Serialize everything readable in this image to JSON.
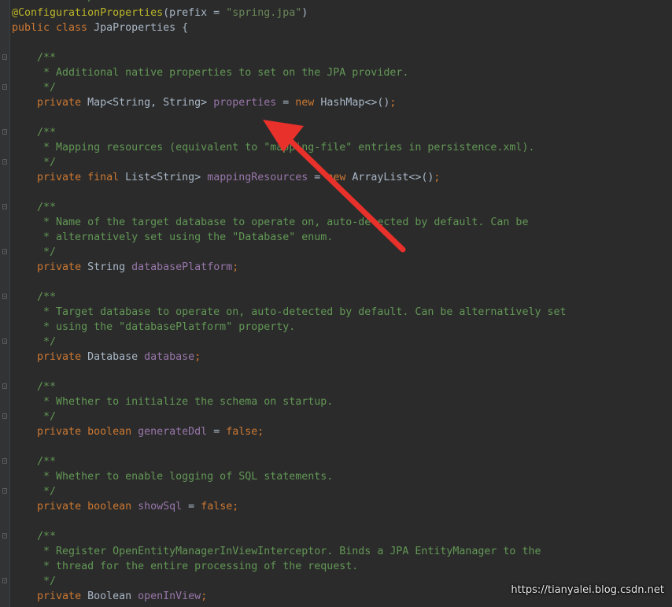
{
  "code_lines": [
    [
      {
        "c": "txt",
        "t": "           "
      },
      {
        "c": "doc",
        "t": "*/"
      }
    ],
    [
      {
        "c": "ann",
        "t": "@ConfigurationProperties"
      },
      {
        "c": "txt",
        "t": "(prefix = "
      },
      {
        "c": "str",
        "t": "\"spring.jpa\""
      },
      {
        "c": "txt",
        "t": ")"
      }
    ],
    [
      {
        "c": "kw",
        "t": "public class "
      },
      {
        "c": "txt",
        "t": "JpaProperties {"
      }
    ],
    [],
    [
      {
        "c": "txt",
        "t": "    "
      },
      {
        "c": "doc",
        "t": "/**"
      }
    ],
    [
      {
        "c": "txt",
        "t": "     "
      },
      {
        "c": "doc",
        "t": "* Additional native properties to set on the JPA provider."
      }
    ],
    [
      {
        "c": "txt",
        "t": "     "
      },
      {
        "c": "doc",
        "t": "*/"
      }
    ],
    [
      {
        "c": "txt",
        "t": "    "
      },
      {
        "c": "kw",
        "t": "private "
      },
      {
        "c": "txt",
        "t": "Map<String, String> "
      },
      {
        "c": "fld",
        "t": "properties"
      },
      {
        "c": "txt",
        "t": " = "
      },
      {
        "c": "kw",
        "t": "new "
      },
      {
        "c": "txt",
        "t": "HashMap<>()"
      },
      {
        "c": "kw",
        "t": ";"
      }
    ],
    [],
    [
      {
        "c": "txt",
        "t": "    "
      },
      {
        "c": "doc",
        "t": "/**"
      }
    ],
    [
      {
        "c": "txt",
        "t": "     "
      },
      {
        "c": "doc",
        "t": "* Mapping resources (equivalent to \"mapping-file\" entries in persistence.xml)."
      }
    ],
    [
      {
        "c": "txt",
        "t": "     "
      },
      {
        "c": "doc",
        "t": "*/"
      }
    ],
    [
      {
        "c": "txt",
        "t": "    "
      },
      {
        "c": "kw",
        "t": "private final "
      },
      {
        "c": "txt",
        "t": "List<String> "
      },
      {
        "c": "fld",
        "t": "mappingResources"
      },
      {
        "c": "txt",
        "t": " = "
      },
      {
        "c": "kw",
        "t": "new "
      },
      {
        "c": "txt",
        "t": "ArrayList<>()"
      },
      {
        "c": "kw",
        "t": ";"
      }
    ],
    [],
    [
      {
        "c": "txt",
        "t": "    "
      },
      {
        "c": "doc",
        "t": "/**"
      }
    ],
    [
      {
        "c": "txt",
        "t": "     "
      },
      {
        "c": "doc",
        "t": "* Name of the target database to operate on, auto-detected by default. Can be"
      }
    ],
    [
      {
        "c": "txt",
        "t": "     "
      },
      {
        "c": "doc",
        "t": "* alternatively set using the \"Database\" enum."
      }
    ],
    [
      {
        "c": "txt",
        "t": "     "
      },
      {
        "c": "doc",
        "t": "*/"
      }
    ],
    [
      {
        "c": "txt",
        "t": "    "
      },
      {
        "c": "kw",
        "t": "private "
      },
      {
        "c": "txt",
        "t": "String "
      },
      {
        "c": "fld",
        "t": "databasePlatform"
      },
      {
        "c": "kw",
        "t": ";"
      }
    ],
    [],
    [
      {
        "c": "txt",
        "t": "    "
      },
      {
        "c": "doc",
        "t": "/**"
      }
    ],
    [
      {
        "c": "txt",
        "t": "     "
      },
      {
        "c": "doc",
        "t": "* Target database to operate on, auto-detected by default. Can be alternatively set"
      }
    ],
    [
      {
        "c": "txt",
        "t": "     "
      },
      {
        "c": "doc",
        "t": "* using the \"databasePlatform\" property."
      }
    ],
    [
      {
        "c": "txt",
        "t": "     "
      },
      {
        "c": "doc",
        "t": "*/"
      }
    ],
    [
      {
        "c": "txt",
        "t": "    "
      },
      {
        "c": "kw",
        "t": "private "
      },
      {
        "c": "txt",
        "t": "Database "
      },
      {
        "c": "fld",
        "t": "database"
      },
      {
        "c": "kw",
        "t": ";"
      }
    ],
    [],
    [
      {
        "c": "txt",
        "t": "    "
      },
      {
        "c": "doc",
        "t": "/**"
      }
    ],
    [
      {
        "c": "txt",
        "t": "     "
      },
      {
        "c": "doc",
        "t": "* Whether to initialize the schema on startup."
      }
    ],
    [
      {
        "c": "txt",
        "t": "     "
      },
      {
        "c": "doc",
        "t": "*/"
      }
    ],
    [
      {
        "c": "txt",
        "t": "    "
      },
      {
        "c": "kw",
        "t": "private boolean "
      },
      {
        "c": "fld",
        "t": "generateDdl"
      },
      {
        "c": "txt",
        "t": " = "
      },
      {
        "c": "kw",
        "t": "false;"
      }
    ],
    [],
    [
      {
        "c": "txt",
        "t": "    "
      },
      {
        "c": "doc",
        "t": "/**"
      }
    ],
    [
      {
        "c": "txt",
        "t": "     "
      },
      {
        "c": "doc",
        "t": "* Whether to enable logging of SQL statements."
      }
    ],
    [
      {
        "c": "txt",
        "t": "     "
      },
      {
        "c": "doc",
        "t": "*/"
      }
    ],
    [
      {
        "c": "txt",
        "t": "    "
      },
      {
        "c": "kw",
        "t": "private boolean "
      },
      {
        "c": "fld",
        "t": "showSql"
      },
      {
        "c": "txt",
        "t": " = "
      },
      {
        "c": "kw",
        "t": "false;"
      }
    ],
    [],
    [
      {
        "c": "txt",
        "t": "    "
      },
      {
        "c": "doc",
        "t": "/**"
      }
    ],
    [
      {
        "c": "txt",
        "t": "     "
      },
      {
        "c": "doc",
        "t": "* Register OpenEntityManagerInViewInterceptor. Binds a JPA EntityManager to the"
      }
    ],
    [
      {
        "c": "txt",
        "t": "     "
      },
      {
        "c": "doc",
        "t": "* thread for the entire processing of the request."
      }
    ],
    [
      {
        "c": "txt",
        "t": "     "
      },
      {
        "c": "doc",
        "t": "*/"
      }
    ],
    [
      {
        "c": "txt",
        "t": "    "
      },
      {
        "c": "kw",
        "t": "private "
      },
      {
        "c": "txt",
        "t": "Boolean "
      },
      {
        "c": "fld",
        "t": "openInView"
      },
      {
        "c": "kw",
        "t": ";"
      }
    ]
  ],
  "watermark": "https://tianyalei.blog.csdn.net",
  "colors": {
    "background": "#2b2b2b",
    "annotation": "#bbb529",
    "keyword": "#cc7832",
    "string": "#6a8759",
    "doc_comment": "#629755",
    "field": "#9876aa",
    "text": "#a9b7c6",
    "arrow": "#e8312a"
  },
  "arrow": {
    "semantic": "red-arrow-pointing-at-properties-field"
  }
}
